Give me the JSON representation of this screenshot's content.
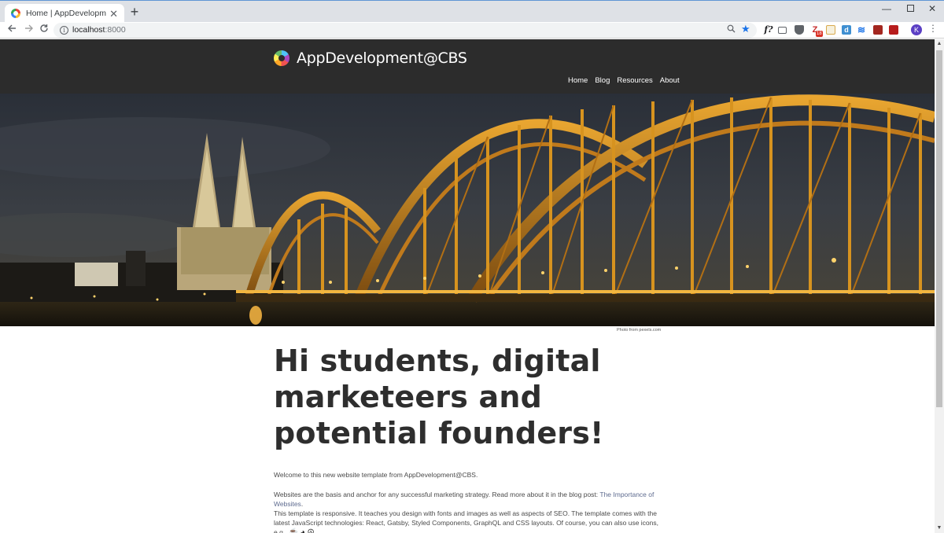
{
  "browser": {
    "tab_title": "Home | AppDevelopment@CBS",
    "tab_close": "✕",
    "new_tab": "+",
    "url_host": "localhost",
    "url_port": ":8000",
    "window_controls": {
      "minimize": "—",
      "close": "✕"
    },
    "extensions": {
      "func": "f?",
      "zotero": "Z",
      "zotero_badge": "18",
      "d": "d",
      "lines": "≋",
      "avatar_initial": "K"
    }
  },
  "site": {
    "title": "AppDevelopment@CBS",
    "nav": [
      "Home",
      "Blog",
      "Resources",
      "About"
    ],
    "photo_credit": "Photo from pexels.com",
    "headline": "Hi students, digital marketeers and potential founders!",
    "paragraphs": {
      "p1": "Welcome to this new website template from AppDevelopment@CBS.",
      "p2_text": "Websites are the basis and anchor for any successful marketing strategy. Read more about it in the blog post: ",
      "p2_link": "The Importance of Websites",
      "p2_end": ".",
      "p3": "This template is responsive. It teaches you design with fonts and images as well as aspects of SEO. The template comes with the latest JavaScript technologies: React, Gatsby, Styled Components, GraphQL and CSS layouts. Of course, you can also use icons, e.g.",
      "p3_icons": "☕ ◕ ☮"
    }
  },
  "colors": {
    "header_bg": "#2c2c2c",
    "headline": "#2e2e2e",
    "link": "#5e6b8f"
  }
}
